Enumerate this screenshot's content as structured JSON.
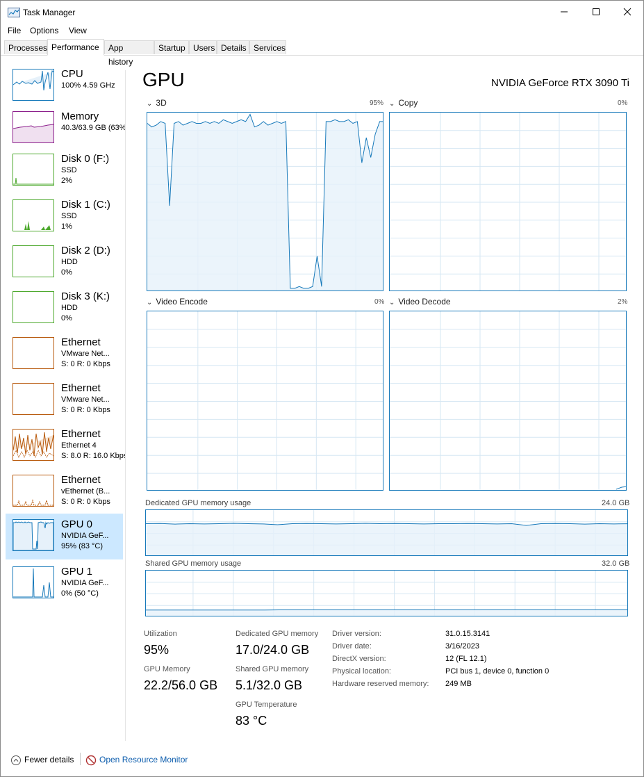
{
  "window": {
    "title": "Task Manager"
  },
  "menu": [
    "File",
    "Options",
    "View"
  ],
  "tabs": [
    "Processes",
    "Performance",
    "App history",
    "Startup",
    "Users",
    "Details",
    "Services"
  ],
  "sidebar": [
    {
      "name": "CPU",
      "l1": "100%  4.59 GHz",
      "l2": ""
    },
    {
      "name": "Memory",
      "l1": "40.3/63.9 GB (63%)",
      "l2": ""
    },
    {
      "name": "Disk 0 (F:)",
      "l1": "SSD",
      "l2": "2%"
    },
    {
      "name": "Disk 1 (C:)",
      "l1": "SSD",
      "l2": "1%"
    },
    {
      "name": "Disk 2 (D:)",
      "l1": "HDD",
      "l2": "0%"
    },
    {
      "name": "Disk 3 (K:)",
      "l1": "HDD",
      "l2": "0%"
    },
    {
      "name": "Ethernet",
      "l1": "VMware Net...",
      "l2": "S: 0  R: 0 Kbps"
    },
    {
      "name": "Ethernet",
      "l1": "VMware Net...",
      "l2": "S: 0  R: 0 Kbps"
    },
    {
      "name": "Ethernet",
      "l1": "Ethernet 4",
      "l2": "S: 8.0  R: 16.0 Kbps"
    },
    {
      "name": "Ethernet",
      "l1": "vEthernet (B...",
      "l2": "S: 0  R: 0 Kbps"
    },
    {
      "name": "GPU 0",
      "l1": "NVIDIA GeF...",
      "l2": "95% (83 °C)"
    },
    {
      "name": "GPU 1",
      "l1": "NVIDIA GeF...",
      "l2": "0% (50 °C)"
    }
  ],
  "colors": {
    "cpu": "#1779ba",
    "memory": "#8b1e8b",
    "disk": "#4ca82c",
    "ethernet": "#b85a0d",
    "gpu": "#1779ba",
    "selected": "#cce8ff",
    "link": "#0b5cad"
  },
  "main": {
    "title": "GPU",
    "gpu_name": "NVIDIA GeForce RTX 3090 Ti",
    "engines": [
      {
        "label": "3D",
        "pct": "95%"
      },
      {
        "label": "Copy",
        "pct": "0%"
      },
      {
        "label": "Video Encode",
        "pct": "0%"
      },
      {
        "label": "Video Decode",
        "pct": "2%"
      }
    ],
    "dedicated_label": "Dedicated GPU memory usage",
    "dedicated_max": "24.0 GB",
    "shared_label": "Shared GPU memory usage",
    "shared_max": "32.0 GB"
  },
  "chart_data": [
    {
      "type": "line",
      "title": "3D",
      "ylim": [
        0,
        100
      ],
      "values": [
        94,
        92,
        93,
        95,
        94,
        48,
        94,
        95,
        93,
        94,
        95,
        94,
        94,
        95,
        94,
        95,
        94,
        96,
        95,
        94,
        95,
        96,
        95,
        99,
        92,
        93,
        95,
        93,
        94,
        95,
        94,
        95,
        2,
        2,
        3,
        2,
        2,
        3,
        20,
        3,
        95,
        95,
        96,
        95,
        95,
        96,
        94,
        95,
        72,
        86,
        75,
        88,
        95,
        95
      ]
    },
    {
      "type": "line",
      "title": "Dedicated GPU memory usage",
      "ylim": [
        0,
        24
      ],
      "values": [
        17.0,
        17.1,
        16.8,
        17.0,
        16.9,
        17.0,
        17.2,
        17.0,
        16.9,
        16.5,
        17.0,
        17.1,
        17.0,
        16.9,
        17.0,
        17.2,
        17.0,
        17.1,
        17.0,
        16.9,
        17.0,
        17.0,
        17.1,
        17.0,
        16.9,
        17.0,
        16.1,
        17.0,
        17.1,
        17.0,
        16.8,
        17.0,
        16.9,
        17.0
      ]
    },
    {
      "type": "line",
      "title": "Shared GPU memory usage",
      "ylim": [
        0,
        32
      ],
      "values": [
        4.9,
        4.9,
        4.9,
        4.9,
        4.9,
        4.9,
        4.9,
        4.9,
        5.0,
        5.0,
        5.0,
        5.0,
        5.0,
        5.0,
        5.0,
        5.0,
        5.0,
        5.0,
        5.0,
        5.0,
        5.0,
        5.1,
        5.1,
        5.1,
        5.1,
        5.1,
        5.1,
        5.1,
        5.1,
        5.1
      ]
    }
  ],
  "stats": {
    "utilization_label": "Utilization",
    "utilization": "95%",
    "ded_mem_label": "Dedicated GPU memory",
    "ded_mem": "17.0/24.0 GB",
    "gpu_mem_label": "GPU Memory",
    "gpu_mem": "22.2/56.0 GB",
    "shared_mem_label": "Shared GPU memory",
    "shared_mem": "5.1/32.0 GB",
    "temp_label": "GPU Temperature",
    "temp": "83 °C"
  },
  "info": [
    {
      "key": "Driver version:",
      "val": "31.0.15.3141"
    },
    {
      "key": "Driver date:",
      "val": "3/16/2023"
    },
    {
      "key": "DirectX version:",
      "val": "12 (FL 12.1)"
    },
    {
      "key": "Physical location:",
      "val": "PCI bus 1, device 0, function 0"
    },
    {
      "key": "Hardware reserved memory:",
      "val": "249 MB"
    }
  ],
  "footer": {
    "fewer": "Fewer details",
    "monitor": "Open Resource Monitor"
  }
}
